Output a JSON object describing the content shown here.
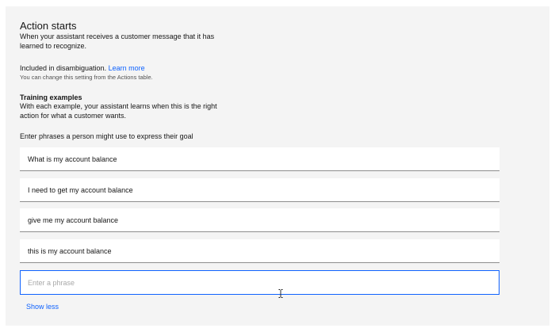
{
  "action_starts": {
    "title": "Action starts",
    "description": "When your assistant receives a customer message that it has learned to recognize.",
    "disambiguation_text": "Included in disambiguation.",
    "learn_more_link": "Learn more",
    "helper_text": "You can change this setting from the Actions table."
  },
  "training": {
    "heading": "Training examples",
    "description": "With each example, your assistant learns when this is the right action for what a customer wants.",
    "phrase_prompt": "Enter phrases a person might use to express their goal",
    "examples": [
      "What is my account balance",
      "I need to get my account balance",
      "give me my account balance",
      "this is my account balance"
    ],
    "new_phrase_placeholder": "Enter a phrase",
    "new_phrase_value": "",
    "show_less_label": "Show less"
  },
  "icons": {
    "text_cursor": "text-cursor-icon"
  },
  "colors": {
    "accent": "#0f62fe",
    "panel_background": "#f4f4f4"
  }
}
